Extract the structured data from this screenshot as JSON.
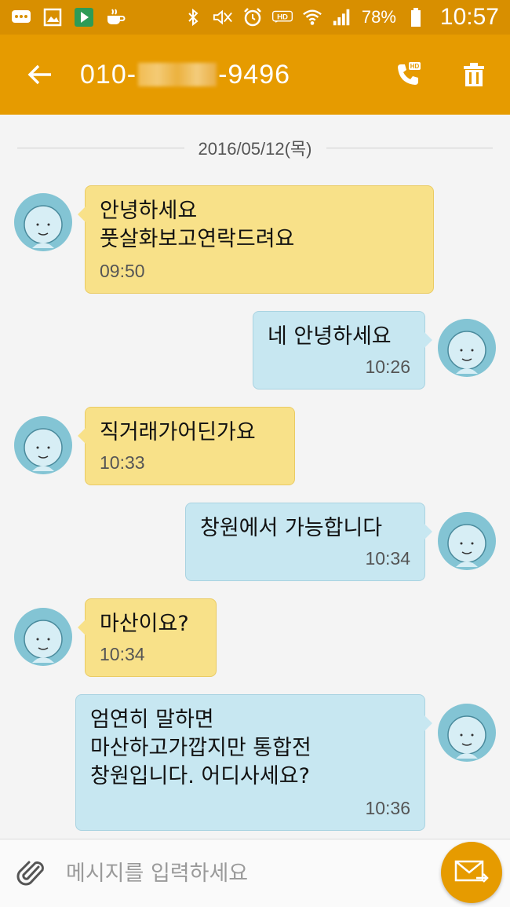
{
  "status_bar": {
    "battery": "78%",
    "time": "10:57"
  },
  "app_bar": {
    "number_prefix": "010-",
    "number_suffix": "-9496"
  },
  "conversation": {
    "date": "2016/05/12(목)",
    "messages": [
      {
        "direction": "incoming",
        "text": "안녕하세요\n풋살화보고연락드려요",
        "time": "09:50"
      },
      {
        "direction": "outgoing",
        "text": "네 안녕하세요",
        "time": "10:26"
      },
      {
        "direction": "incoming",
        "text": "직거래가어딘가요",
        "time": "10:33"
      },
      {
        "direction": "outgoing",
        "text": "창원에서 가능합니다",
        "time": "10:34"
      },
      {
        "direction": "incoming",
        "text": "마산이요?",
        "time": "10:34"
      },
      {
        "direction": "outgoing",
        "text": "엄연히 말하면\n마산하고가깝지만 통합전\n창원입니다. 어디사세요?",
        "time": "10:36"
      }
    ]
  },
  "input": {
    "placeholder": "메시지를 입력하세요"
  },
  "colors": {
    "status_bar": "#d88f00",
    "app_bar": "#e69b00",
    "incoming_bubble": "#f8e189",
    "outgoing_bubble": "#c7e7f1",
    "avatar": "#83c4d4"
  }
}
